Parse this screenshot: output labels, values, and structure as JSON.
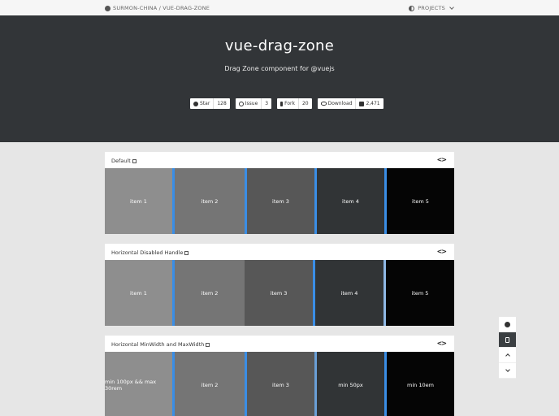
{
  "nav": {
    "breadcrumb": "SURMON-CHINA / VUE-DRAG-ZONE",
    "projects_label": "PROJECTS"
  },
  "hero": {
    "title": "vue-drag-zone",
    "subtitle": "Drag Zone component for @vuejs"
  },
  "badges": [
    {
      "label": "Star",
      "count": "128",
      "icon": "github-icon"
    },
    {
      "label": "Issue",
      "count": "3",
      "icon": "issue-icon"
    },
    {
      "label": "Fork",
      "count": "20",
      "icon": "fork-icon"
    },
    {
      "label": "Download",
      "count": "2,471",
      "icon": "download-icon"
    }
  ],
  "sections": [
    {
      "title": "Default",
      "items": [
        "item 1",
        "item 2",
        "item 3",
        "item 4",
        "item 5"
      ]
    },
    {
      "title": "Horizontal Disabled Handle",
      "items": [
        "item 1",
        "item 2",
        "item 3",
        "item 4",
        "item 5"
      ]
    },
    {
      "title": "Horizontal MinWidth and MaxWidth",
      "items": [
        "min 100px && max 30rem",
        "item 2",
        "item 3",
        "min 50px",
        "min 10em"
      ]
    }
  ],
  "colors": {
    "hero_bg": "#323538",
    "handle": "#3a8ee6",
    "item1": "#8e8e8e",
    "item2": "#757575",
    "item3": "#575757",
    "item4": "#313436",
    "item5": "#050505"
  },
  "sidebar": {
    "buttons": [
      "github-icon",
      "save-icon",
      "chevron-up-icon",
      "chevron-down-icon"
    ]
  }
}
